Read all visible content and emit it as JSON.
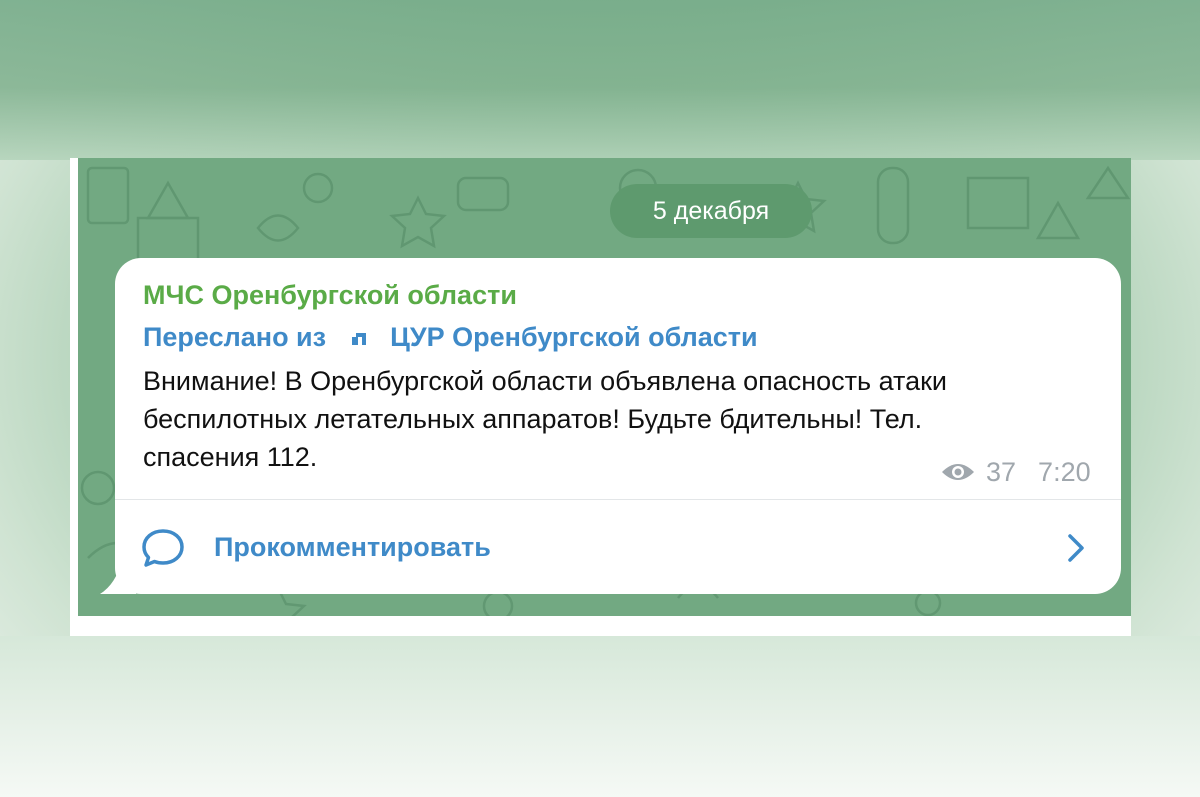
{
  "date_separator": "5 декабря",
  "message": {
    "sender": "МЧС Оренбургской области",
    "forwarded_prefix": "Переслано из",
    "forwarded_source": "ЦУР Оренбургской области",
    "text_lines": [
      "Внимание! В Оренбургской области объявлена опасность атаки",
      "беспилотных летательных аппаратов! Будьте бдительны! Тел.",
      "спасения 112."
    ],
    "views": "37",
    "time": "7:20",
    "comment_label": "Прокомментировать"
  },
  "icons": {
    "forward": "forward-channel-icon",
    "views": "eye-icon",
    "comment": "speech-bubble-icon",
    "chevron": "chevron-right-icon"
  },
  "colors": {
    "chat_background": "#72a982",
    "date_pill": "#5e9a6e",
    "sender": "#5aab47",
    "link": "#3f8ac8",
    "meta": "#a0a7ad"
  }
}
